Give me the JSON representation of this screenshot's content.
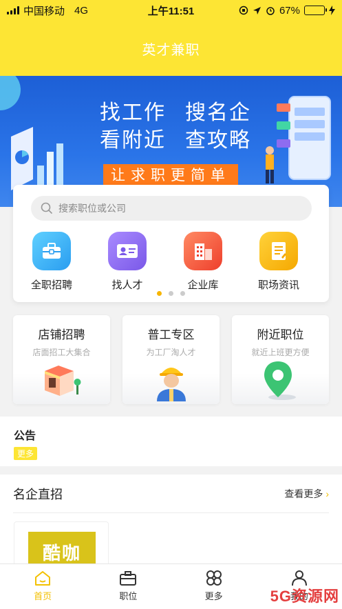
{
  "status_bar": {
    "carrier": "中国移动",
    "network": "4G",
    "time": "上午11:51",
    "battery_percent": "67%",
    "battery_level": 0.67
  },
  "header": {
    "title": "英才兼职"
  },
  "banner": {
    "slogan_line1_a": "找工作",
    "slogan_line1_b": "搜名企",
    "slogan_line2_a": "看附近",
    "slogan_line2_b": "查攻略",
    "tagline": "让求职更简单"
  },
  "search": {
    "placeholder": "搜索职位或公司"
  },
  "quick_actions": [
    {
      "label": "全职招聘",
      "icon": "briefcase-icon",
      "color": "#35b6f5"
    },
    {
      "label": "找人才",
      "icon": "id-card-icon",
      "color": "#8e6cf0"
    },
    {
      "label": "企业库",
      "icon": "building-icon",
      "color": "#f55a3e"
    },
    {
      "label": "职场资讯",
      "icon": "document-icon",
      "color": "#f5b800"
    }
  ],
  "carousel": {
    "pages": 3,
    "active": 0
  },
  "features": [
    {
      "title": "店铺招聘",
      "subtitle": "店面招工大集合",
      "icon": "shop-icon"
    },
    {
      "title": "普工专区",
      "subtitle": "为工厂淘人才",
      "icon": "worker-icon"
    },
    {
      "title": "附近职位",
      "subtitle": "就近上班更方便",
      "icon": "location-pin-icon"
    }
  ],
  "notice": {
    "title": "公告",
    "more": "更多"
  },
  "famous": {
    "title": "名企直招",
    "more": "查看更多",
    "companies": [
      {
        "logo_text": "酷咖"
      }
    ]
  },
  "tabbar": [
    {
      "label": "首页",
      "icon": "home-icon",
      "active": true
    },
    {
      "label": "职位",
      "icon": "briefcase-icon",
      "active": false
    },
    {
      "label": "更多",
      "icon": "grid-icon",
      "active": false
    },
    {
      "label": "我的",
      "icon": "user-icon",
      "active": false
    }
  ],
  "watermark": "5G资源网",
  "colors": {
    "brand_yellow": "#fde534",
    "accent": "#f3c000",
    "banner_blue": "#2a74e8"
  }
}
